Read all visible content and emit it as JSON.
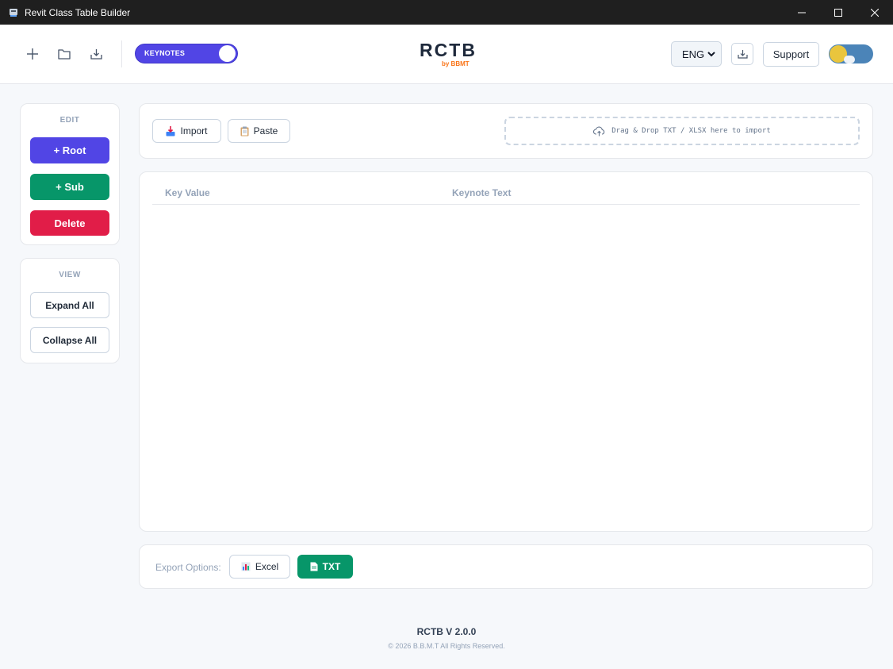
{
  "window": {
    "title": "Revit Class Table Builder",
    "controls": [
      "minimize",
      "maximize",
      "close"
    ]
  },
  "header": {
    "icons": [
      "plus-icon",
      "folder-icon",
      "download-icon"
    ],
    "mode_toggle": {
      "label": "KEYNOTES",
      "on": true
    },
    "logo": {
      "title": "RCTB",
      "subtitle": "by BBMT"
    },
    "language": {
      "selected": "ENG"
    },
    "support_label": "Support",
    "theme_toggle": {
      "state": "light"
    }
  },
  "sidebar": {
    "edit": {
      "title": "EDIT",
      "root_label": "+  Root",
      "sub_label": "+  Sub",
      "delete_label": "Delete"
    },
    "view": {
      "title": "VIEW",
      "expand_label": "Expand All",
      "collapse_label": "Collapse All"
    }
  },
  "import_bar": {
    "import_label": "Import",
    "paste_label": "Paste",
    "dropzone_text": "Drag & Drop TXT / XLSX here to import"
  },
  "table": {
    "columns": [
      "Key Value",
      "Keynote Text"
    ],
    "rows": []
  },
  "export": {
    "label": "Export Options:",
    "excel_label": "Excel",
    "txt_label": "TXT"
  },
  "footer": {
    "version": "RCTB V 2.0.0",
    "copyright": "© 2026 B.B.M.T All Rights Reserved."
  },
  "colors": {
    "primary": "#5145e5",
    "success": "#079669",
    "danger": "#e11d48",
    "accent_orange": "#f97316"
  }
}
